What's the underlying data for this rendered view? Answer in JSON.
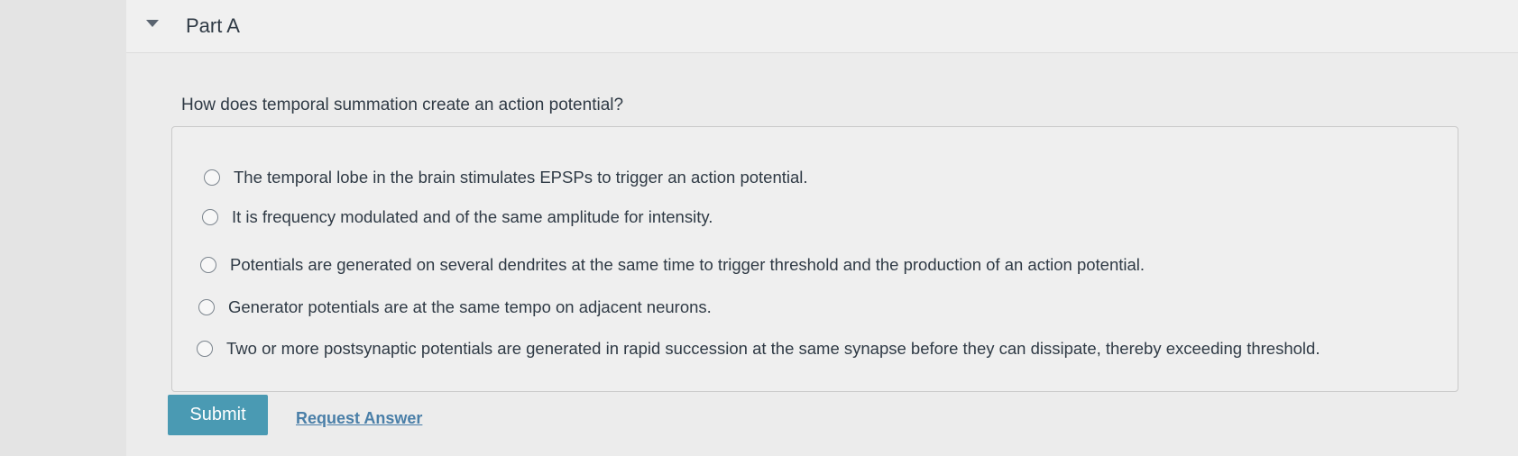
{
  "part": {
    "title": "Part A"
  },
  "question": {
    "text": "How does temporal summation create an action potential?"
  },
  "options": [
    {
      "label": "The temporal lobe in the brain stimulates EPSPs to trigger an action potential."
    },
    {
      "label": "It is frequency modulated and of the same amplitude for intensity."
    },
    {
      "label": "Potentials are generated on several dendrites at the same time to trigger threshold and the production of an action potential."
    },
    {
      "label": "Generator potentials are at the same tempo on adjacent neurons."
    },
    {
      "label": "Two or more postsynaptic potentials are generated in rapid succession at the same synapse before they can dissipate, thereby exceeding threshold."
    }
  ],
  "actions": {
    "submit_label": "Submit",
    "request_answer_label": "Request Answer"
  },
  "colors": {
    "submit_button": "#4a9ab3",
    "link": "#4a7fa8",
    "text": "#2f3a45"
  }
}
